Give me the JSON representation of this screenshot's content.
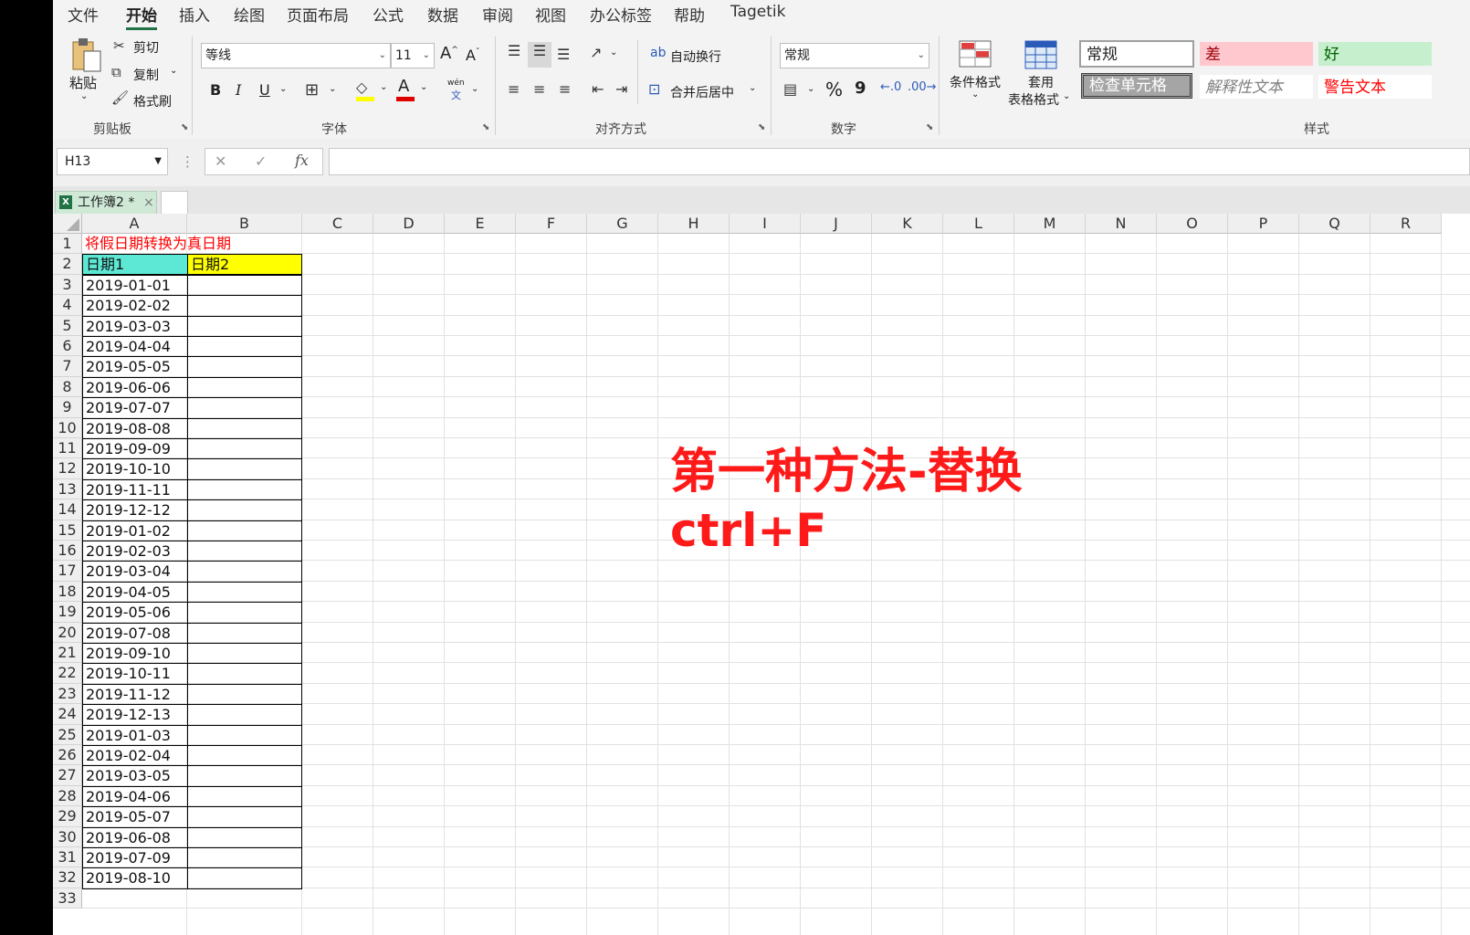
{
  "menu": [
    "文件",
    "开始",
    "插入",
    "绘图",
    "页面布局",
    "公式",
    "数据",
    "审阅",
    "视图",
    "办公标签",
    "帮助",
    "Tagetik"
  ],
  "menu_active_index": 1,
  "clipboard": {
    "paste": "粘贴",
    "cut": "剪切",
    "copy": "复制",
    "format_painter": "格式刷",
    "group_label": "剪贴板"
  },
  "font": {
    "name": "等线",
    "size": "11",
    "bold": "B",
    "italic": "I",
    "underline": "U",
    "phonetic": "wén",
    "phonetic_sub": "文",
    "group_label": "字体"
  },
  "alignment": {
    "wrap_text": "自动换行",
    "merge_center": "合并后居中",
    "group_label": "对齐方式"
  },
  "number": {
    "format": "常规",
    "percent": "%",
    "comma": "9",
    "group_label": "数字"
  },
  "styles": {
    "conditional_formatting": "条件格式",
    "format_as_table_line1": "套用",
    "format_as_table_line2": "表格格式",
    "cells": [
      {
        "label": "常规",
        "color": "#222222",
        "bg": "#ffffff"
      },
      {
        "label": "差",
        "color": "#9c0006",
        "bg": "#ffc7ce"
      },
      {
        "label": "好",
        "color": "#006100",
        "bg": "#c6efce"
      },
      {
        "label": "检查单元格",
        "color": "#ffffff",
        "bg": "#a5a5a5"
      },
      {
        "label": "解释性文本",
        "color": "#7f7f7f",
        "bg": "#ffffff"
      },
      {
        "label": "警告文本",
        "color": "#ff0000",
        "bg": "#ffffff"
      }
    ],
    "group_label": "样式"
  },
  "formula_bar": {
    "name_box": "H13",
    "fx": "fx",
    "cancel": "✕",
    "enter": "✓",
    "value": ""
  },
  "workbook_tab": {
    "label": "工作簿2 *",
    "close": "×"
  },
  "columns": [
    "A",
    "B",
    "C",
    "D",
    "E",
    "F",
    "G",
    "H",
    "I",
    "J",
    "K",
    "L",
    "M",
    "N",
    "O",
    "P",
    "Q",
    "R"
  ],
  "rows": [
    "1",
    "2",
    "3",
    "4",
    "5",
    "6",
    "7",
    "8",
    "9",
    "10",
    "11",
    "12",
    "13",
    "14",
    "15",
    "16",
    "17",
    "18",
    "19",
    "20",
    "21",
    "22",
    "23",
    "24",
    "25",
    "26",
    "27",
    "28",
    "29",
    "30",
    "31",
    "32",
    "33"
  ],
  "sheet": {
    "title": "将假日期转换为真日期",
    "header_a": "日期1",
    "header_b": "日期2",
    "dates": [
      "2019-01-01",
      "2019-02-02",
      "2019-03-03",
      "2019-04-04",
      "2019-05-05",
      "2019-06-06",
      "2019-07-07",
      "2019-08-08",
      "2019-09-09",
      "2019-10-10",
      "2019-11-11",
      "2019-12-12",
      "2019-01-02",
      "2019-02-03",
      "2019-03-04",
      "2019-04-05",
      "2019-05-06",
      "2019-07-08",
      "2019-09-10",
      "2019-10-11",
      "2019-11-12",
      "2019-12-13",
      "2019-01-03",
      "2019-02-04",
      "2019-03-05",
      "2019-04-06",
      "2019-05-07",
      "2019-06-08",
      "2019-07-09",
      "2019-08-10"
    ]
  },
  "overlay": {
    "line1": "第一种方法-替换",
    "line2": "ctrl+F"
  },
  "colors": {
    "title_red": "#ff0000",
    "header_a_bg": "#5ce8d4",
    "header_b_bg": "#ffff00",
    "excel_green": "#217346",
    "overlay_red": "#ff1a1a"
  }
}
